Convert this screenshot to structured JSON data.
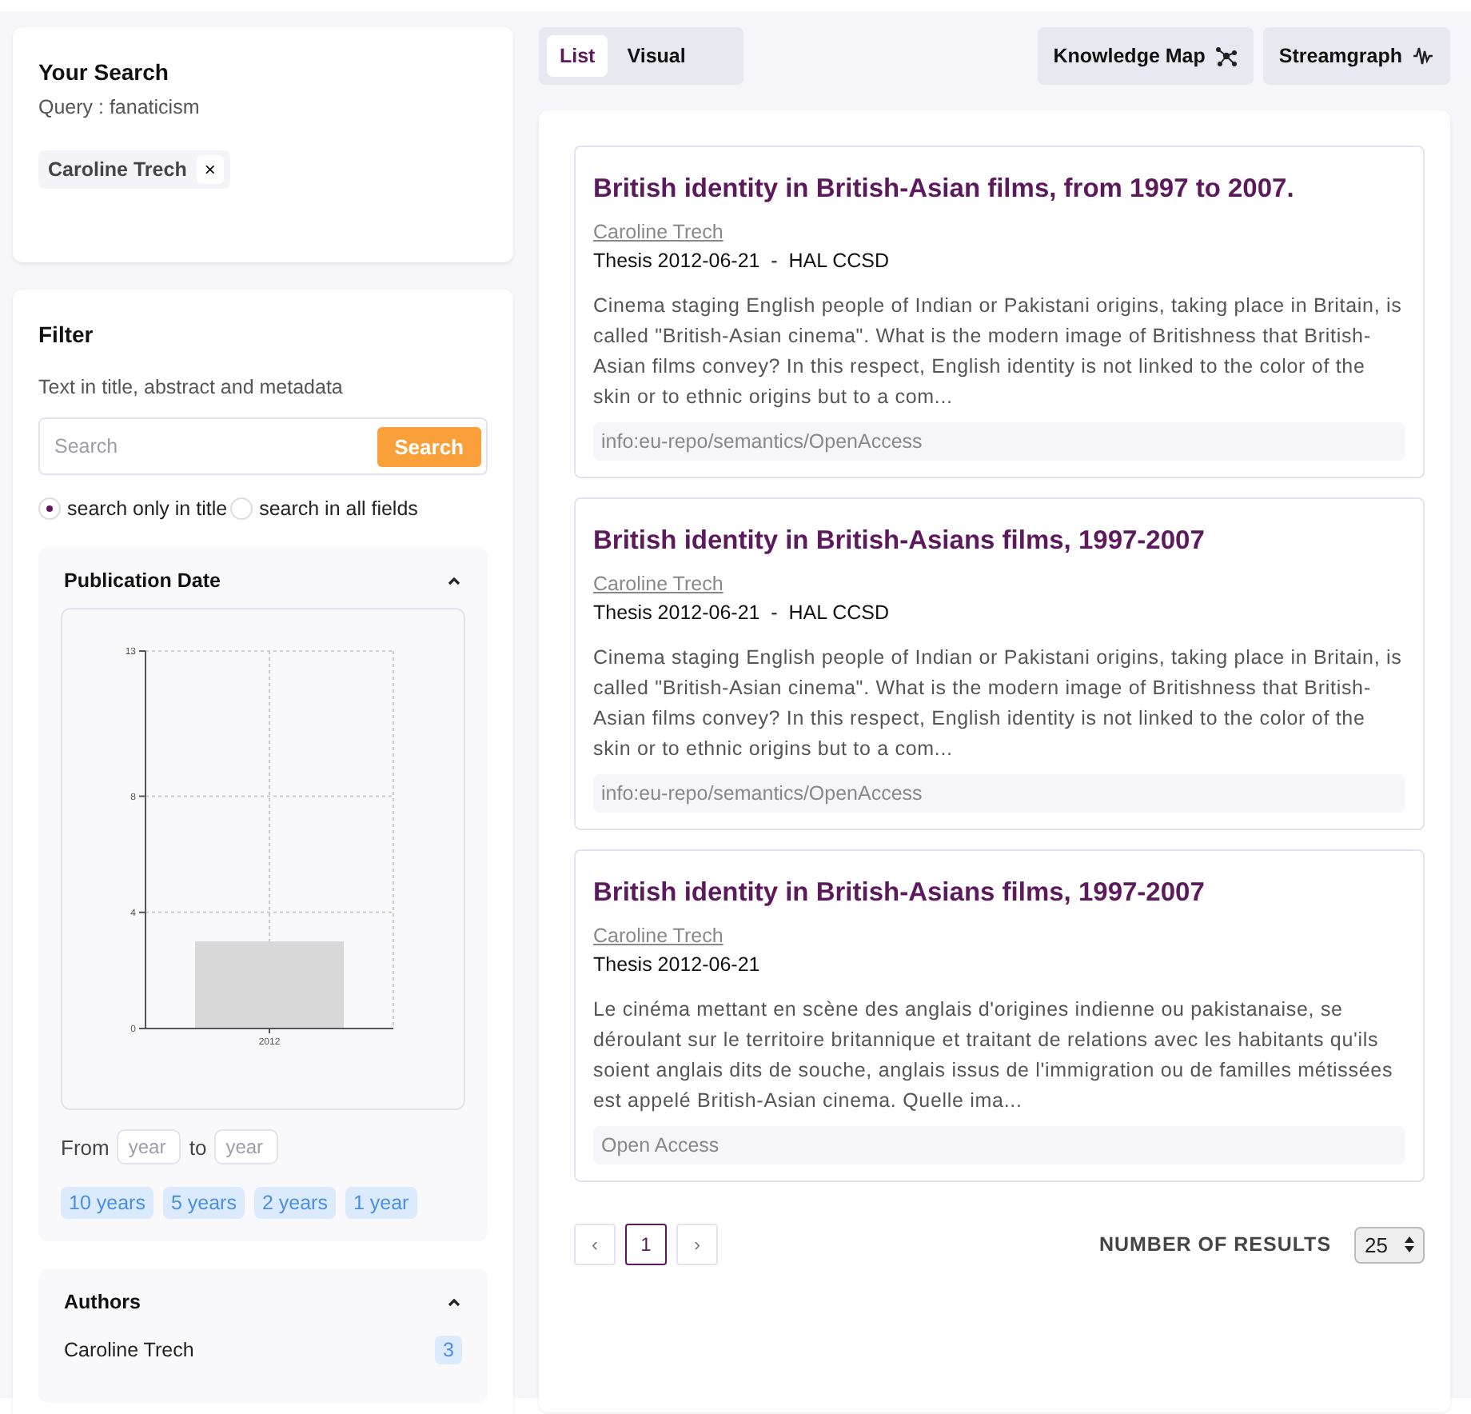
{
  "your_search": {
    "title": "Your Search",
    "query": "Query : fanaticism",
    "tags": [
      {
        "label": "Caroline Trech",
        "remove": "×"
      }
    ]
  },
  "filter": {
    "title": "Filter",
    "search_label": "Text in title, abstract and metadata",
    "search": {
      "placeholder": "Search",
      "button": "Search"
    },
    "scope": [
      {
        "label": "search only in title",
        "selected": true
      },
      {
        "label": "search in all fields",
        "selected": false
      }
    ],
    "publication_date": {
      "title": "Publication Date",
      "expanded": true,
      "chart_data": {
        "type": "bar",
        "categories": [
          "2012"
        ],
        "values": [
          3
        ],
        "ylim": [
          0,
          13
        ],
        "yticks": [
          0,
          4,
          8,
          13
        ],
        "grid": true
      },
      "from_label": "From",
      "from": {
        "placeholder": "year"
      },
      "to_label": "to",
      "to": {
        "placeholder": "year"
      },
      "ranges": [
        "10 years",
        "5 years",
        "2 years",
        "1 year"
      ]
    },
    "authors": {
      "title": "Authors",
      "expanded": true,
      "items": [
        {
          "name": "Caroline Trech",
          "count": "3"
        }
      ]
    }
  },
  "view_tabs": [
    {
      "label": "List",
      "selected": true
    },
    {
      "label": "Visual",
      "selected": false
    }
  ],
  "visual_buttons": [
    {
      "label": "Knowledge Map",
      "kind": "network"
    },
    {
      "label": "Streamgraph",
      "kind": "wave"
    }
  ],
  "results": [
    {
      "title": "British identity in British-Asian films, from 1997 to 2007.",
      "author": "Caroline Trech",
      "meta": "Thesis 2012-06-21  -  HAL CCSD",
      "abstract": "Cinema staging English people of Indian or Pakistani origins, taking place in Britain, is called \"British-Asian cinema\". What is the modern image of Britishness that British-Asian films convey? In this respect, English identity is not linked to the color of the skin or to ethnic origins but to a com...",
      "rights": "info:eu-repo/semantics/OpenAccess"
    },
    {
      "title": "British identity in British-Asians films, 1997-2007",
      "author": "Caroline Trech",
      "meta": "Thesis 2012-06-21  -  HAL CCSD",
      "abstract": "Cinema staging English people of Indian or Pakistani origins, taking place in Britain, is called \"British-Asian cinema\". What is the modern image of Britishness that British-Asian films convey? In this respect, English identity is not linked to the color of the skin or to ethnic origins but to a com...",
      "rights": "info:eu-repo/semantics/OpenAccess"
    },
    {
      "title": "British identity in British-Asians films, 1997-2007",
      "author": "Caroline Trech",
      "meta": "Thesis 2012-06-21",
      "abstract": "Le cinéma mettant en scène des anglais d'origines indienne ou pakistanaise, se déroulant sur le territoire britannique et traitant de relations avec les habitants qu'ils soient anglais dits de souche, anglais issus de l'immigration ou de familles métissées est appelé British-Asian cinema. Quelle ima...",
      "rights": "Open Access"
    }
  ],
  "pagination": {
    "prev": "‹",
    "pages": [
      {
        "label": "1",
        "selected": true
      }
    ],
    "next": "›"
  },
  "results_count": {
    "label": "NUMBER OF RESULTS",
    "value": "25"
  }
}
